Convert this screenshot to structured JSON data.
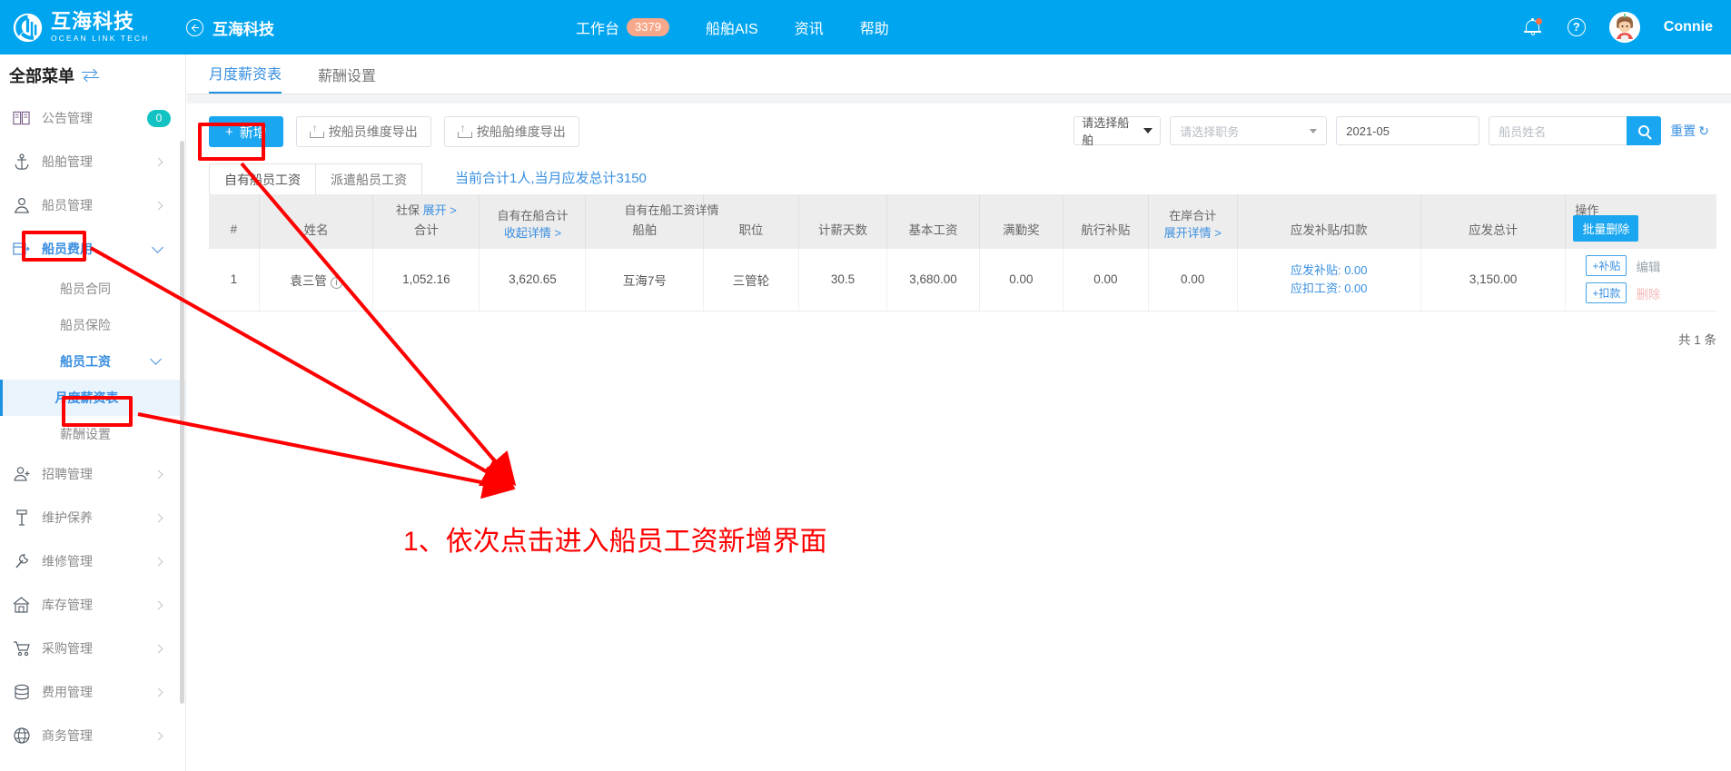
{
  "brand": {
    "name_cn": "互海科技",
    "name_en": "OCEAN LINK TECH",
    "logo_icon": "ocean-link-logo"
  },
  "header": {
    "back_icon": "back-arrow-circle-icon",
    "back_title": "互海科技",
    "nav": [
      {
        "label": "工作台",
        "badge": "3379"
      },
      {
        "label": "船舶AIS",
        "badge": ""
      },
      {
        "label": "资讯",
        "badge": ""
      },
      {
        "label": "帮助",
        "badge": ""
      }
    ],
    "bell_icon": "notification-bell-icon",
    "help_icon": "help-circle-icon",
    "avatar_icon": "user-avatar",
    "user_name": "Connie"
  },
  "sidebar": {
    "title": "全部菜单",
    "swap_icon": "swap-arrows-icon",
    "items": [
      {
        "label": "公告管理",
        "icon": "announcement-icon",
        "badge": "0",
        "chevron": ""
      },
      {
        "label": "船舶管理",
        "icon": "anchor-icon",
        "badge": "",
        "chevron": "right"
      },
      {
        "label": "船员管理",
        "icon": "person-icon",
        "badge": "",
        "chevron": "right"
      },
      {
        "label": "船员费用",
        "icon": "expense-card-icon",
        "badge": "",
        "chevron": "down",
        "active": true
      }
    ],
    "sub_items": [
      {
        "label": "船员合同",
        "type": "leaf"
      },
      {
        "label": "船员保险",
        "type": "leaf"
      },
      {
        "label": "船员工资",
        "type": "group",
        "chevron": "down"
      },
      {
        "label": "月度薪资表",
        "type": "leaf",
        "selected": true
      },
      {
        "label": "薪酬设置",
        "type": "leaf"
      }
    ],
    "items_lower": [
      {
        "label": "招聘管理",
        "icon": "person-add-icon",
        "chevron": "right"
      },
      {
        "label": "维护保养",
        "icon": "maintenance-icon",
        "chevron": "right"
      },
      {
        "label": "维修管理",
        "icon": "wrench-icon",
        "chevron": "right"
      },
      {
        "label": "库存管理",
        "icon": "warehouse-icon",
        "chevron": "right"
      },
      {
        "label": "采购管理",
        "icon": "cart-icon",
        "chevron": "right"
      },
      {
        "label": "费用管理",
        "icon": "database-icon",
        "chevron": "right"
      },
      {
        "label": "商务管理",
        "icon": "globe-icon",
        "chevron": "right"
      }
    ]
  },
  "tabs": [
    {
      "label": "月度薪资表",
      "active": true
    },
    {
      "label": "薪酬设置",
      "active": false
    }
  ],
  "toolbar": {
    "add_label": "新增",
    "add_icon": "plus-icon",
    "export_crew_label": "按船员维度导出",
    "export_ship_label": "按船舶维度导出",
    "export_icon": "upload-icon"
  },
  "filters": {
    "ship_select": "请选择船舶",
    "duty_placeholder": "请选择职务",
    "month_value": "2021-05",
    "name_placeholder": "船员姓名",
    "search_icon": "search-icon",
    "reset_label": "重置",
    "reset_icon": "refresh-icon"
  },
  "subtabs": [
    {
      "label": "自有船员工资",
      "active": true
    },
    {
      "label": "派遣船员工资",
      "active": false
    }
  ],
  "summary": "当前合计1人,当月应发总计3150",
  "table": {
    "groups": {
      "social_insurance": "社保",
      "social_insurance_expand": "展开 >",
      "own_onboard_total": "自有在船合计",
      "own_onboard_collapse": "收起详情 >",
      "own_onboard_detail": "自有在船工资详情",
      "onshore_total": "在岸合计",
      "onshore_expand": "展开详情 >",
      "operation": "操作"
    },
    "headers": {
      "index": "#",
      "name": "姓名",
      "social_total": "合计",
      "ship": "船舶",
      "position": "职位",
      "paid_days": "计薪天数",
      "base_salary": "基本工资",
      "attendance_bonus": "满勤奖",
      "voyage_subsidy": "航行补贴",
      "payable_subsidy_deduction": "应发补贴/扣款",
      "payable_total": "应发总计"
    },
    "batch_delete_label": "批量删除",
    "rows": [
      {
        "index": "1",
        "name": "袁三管",
        "name_info_icon": "info-icon",
        "social_total": "1,052.16",
        "own_onboard_total": "3,620.65",
        "ship": "互海7号",
        "position": "三管轮",
        "paid_days": "30.5",
        "base_salary": "3,680.00",
        "attendance_bonus": "0.00",
        "voyage_subsidy": "0.00",
        "onshore_total": "0.00",
        "payable_subsidy_label": "应发补贴:",
        "payable_subsidy_value": "0.00",
        "deduction_label": "应扣工资:",
        "deduction_value": "0.00",
        "payable_total": "3,150.00",
        "add_subsidy_label": "+补贴",
        "add_deduction_label": "+扣款",
        "edit_label": "编辑",
        "delete_label": "删除"
      }
    ],
    "footer_count": "共 1 条"
  },
  "annotation": {
    "step_text": "1、依次点击进入船员工资新增界面",
    "color": "#ff0000"
  },
  "colors": {
    "brand_blue": "#00a5f0",
    "accent_blue": "#1aa6f0",
    "link_blue": "#3a8fe0",
    "badge_orange": "#f8a88a",
    "badge_teal": "#13c2c2",
    "annotation_red": "#ff0000"
  }
}
